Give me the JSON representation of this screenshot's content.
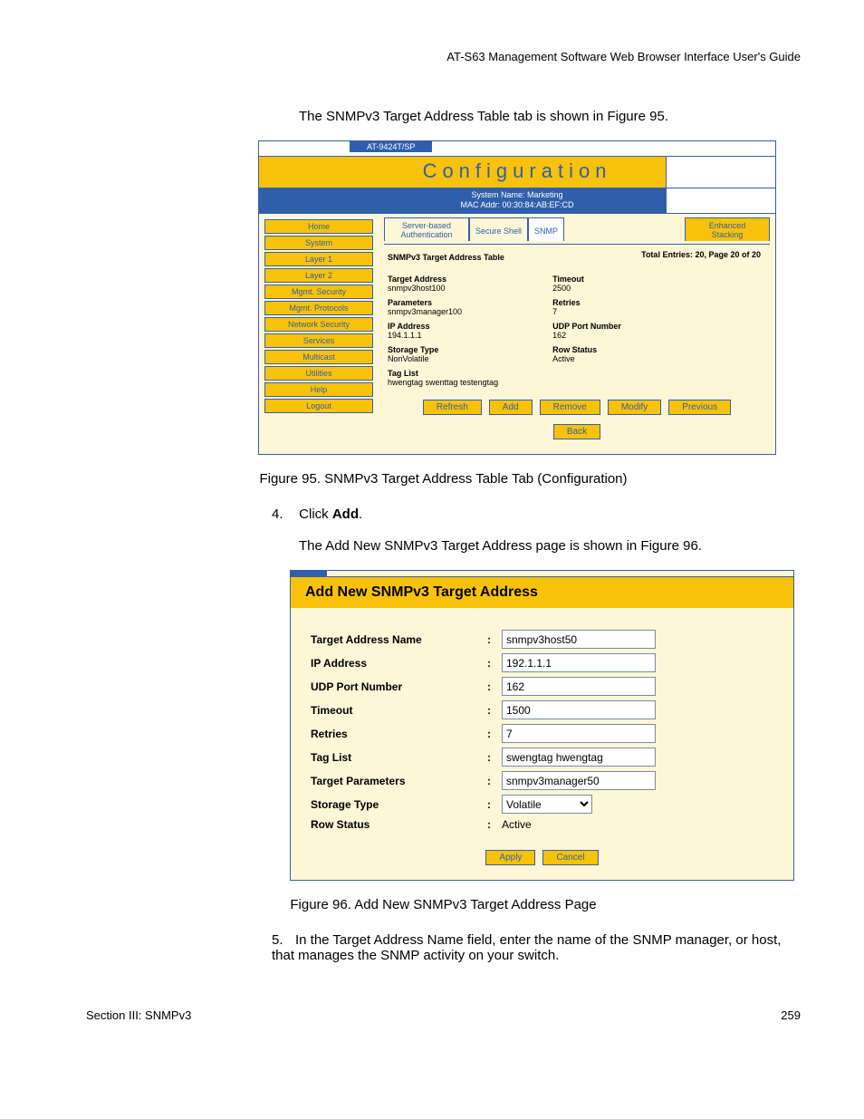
{
  "header_guide": "AT-S63 Management Software Web Browser Interface User's Guide",
  "intro_text": "The SNMPv3 Target Address Table tab is shown in Figure 95.",
  "fig95": {
    "device_model": "AT-9424T/SP",
    "banner": "Configuration",
    "sysname_line": "System Name: Marketing",
    "mac_line": "MAC Addr: 00:30:84:AB:EF:CD",
    "sidebar": [
      "Home",
      "System",
      "Layer 1",
      "Layer 2",
      "Mgmt. Security",
      "Mgmt. Protocols",
      "Network Security",
      "Services",
      "Multicast",
      "Utilities",
      "Help",
      "Logout"
    ],
    "tabs": {
      "t1a": "Server-based",
      "t1b": "Authentication",
      "t2": "Secure Shell",
      "t3": "SNMP",
      "t4a": "Enhanced",
      "t4b": "Stacking"
    },
    "section_title": "SNMPv3 Target Address Table",
    "entries_text": "Total Entries: 20, Page 20 of 20",
    "left_kv": [
      {
        "k": "Target Address",
        "v": "snmpv3host100"
      },
      {
        "k": "Parameters",
        "v": "snmpv3manager100"
      },
      {
        "k": "IP Address",
        "v": "194.1.1.1"
      },
      {
        "k": "Storage Type",
        "v": "NonVolatile"
      },
      {
        "k": "Tag List",
        "v": "hwengtag swenttag testengtag"
      }
    ],
    "right_kv": [
      {
        "k": "Timeout",
        "v": "2500"
      },
      {
        "k": "Retries",
        "v": "7"
      },
      {
        "k": "UDP Port Number",
        "v": "162"
      },
      {
        "k": "Row Status",
        "v": "Active"
      }
    ],
    "buttons_row1": [
      "Refresh",
      "Add",
      "Remove",
      "Modify",
      "Previous"
    ],
    "buttons_row2": [
      "Back"
    ]
  },
  "fig95_caption": "Figure 95. SNMPv3 Target Address Table Tab (Configuration)",
  "step4_num": "4.",
  "step4_text_a": "Click ",
  "step4_text_b": "Add",
  "step4_text_c": ".",
  "step4_follow": "The Add New SNMPv3 Target Address page is shown in Figure 96.",
  "fig96": {
    "title": "Add New SNMPv3 Target Address",
    "rows": [
      {
        "lbl": "Target Address Name",
        "val": "snmpv3host50",
        "type": "text"
      },
      {
        "lbl": "IP Address",
        "val": "192.1.1.1",
        "type": "text"
      },
      {
        "lbl": "UDP Port Number",
        "val": "162",
        "type": "text"
      },
      {
        "lbl": "Timeout",
        "val": "1500",
        "type": "text"
      },
      {
        "lbl": "Retries",
        "val": "7",
        "type": "text"
      },
      {
        "lbl": "Tag List",
        "val": "swengtag hwengtag",
        "type": "text"
      },
      {
        "lbl": "Target Parameters",
        "val": "snmpv3manager50",
        "type": "text"
      },
      {
        "lbl": "Storage Type",
        "val": "Volatile",
        "type": "select"
      },
      {
        "lbl": "Row Status",
        "val": "Active",
        "type": "static"
      }
    ],
    "buttons": [
      "Apply",
      "Cancel"
    ]
  },
  "fig96_caption": "Figure 96. Add New SNMPv3 Target Address Page",
  "step5_num": "5.",
  "step5_text": "In the Target Address Name field, enter the name of the SNMP manager, or host, that manages the SNMP activity on your switch.",
  "footer_left": "Section III: SNMPv3",
  "footer_right": "259"
}
